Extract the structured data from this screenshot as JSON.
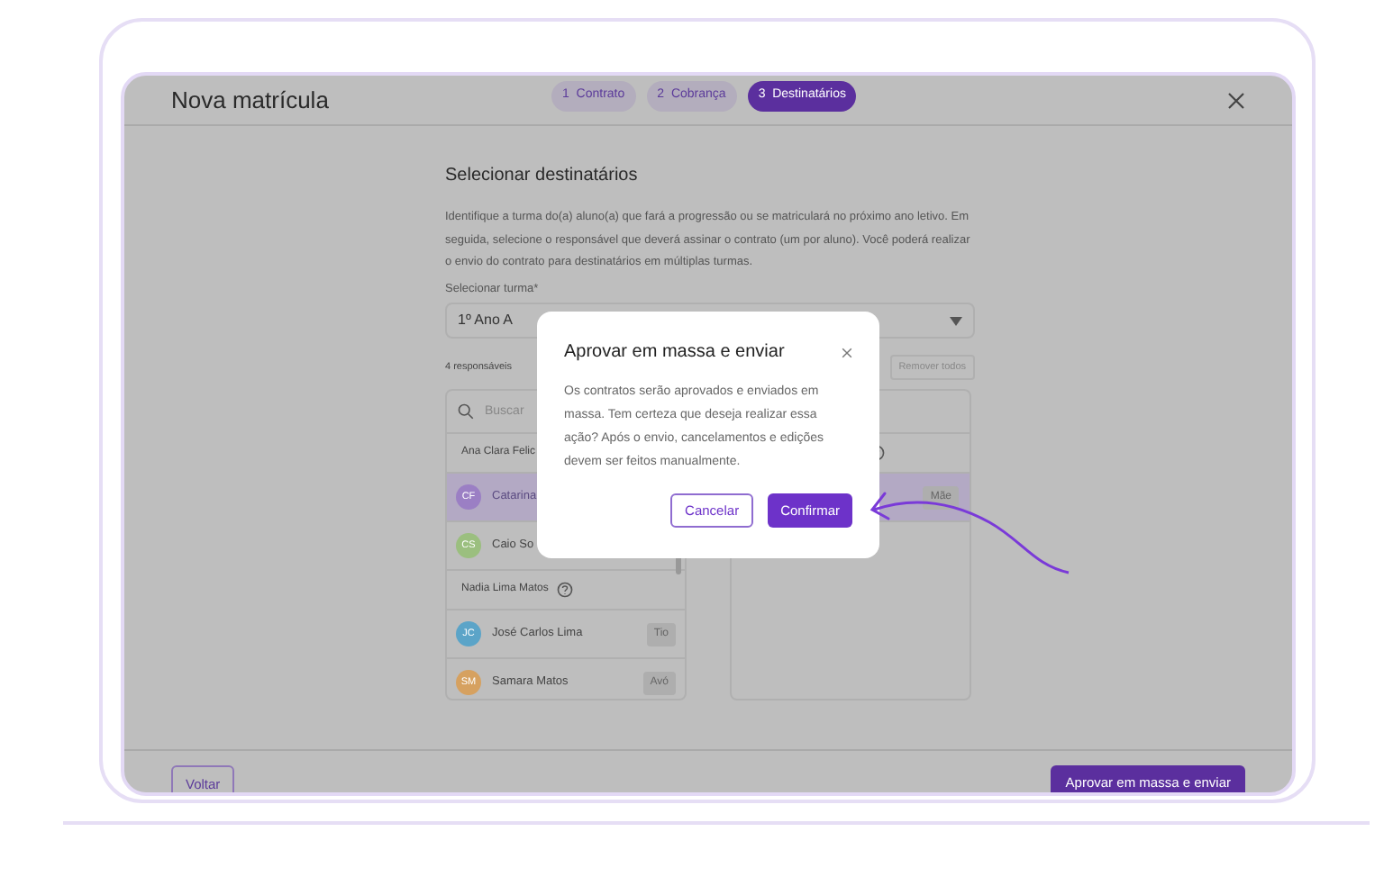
{
  "header": {
    "title": "Nova matrícula",
    "steps": [
      {
        "number": "1",
        "label": "Contrato",
        "selected": false
      },
      {
        "number": "2",
        "label": "Cobrança",
        "selected": false
      },
      {
        "number": "3",
        "label": "Destinatários",
        "selected": true
      }
    ]
  },
  "content": {
    "title": "Selecionar destinatários",
    "description": "Identifique a turma do(a) aluno(a) que fará a progressão ou se matriculará no próximo ano letivo. Em seguida, selecione o responsável que deverá assinar o contrato (um por aluno). Você poderá realizar o envio do contrato para destinatários em múltiplas turmas.",
    "class_select": {
      "label": "Selecionar turma*",
      "value": "1º Ano A"
    },
    "count": "4 responsáveis",
    "remove_all": "Remover todos",
    "search": {
      "placeholder": "Buscar"
    },
    "groups": [
      {
        "name": "Ana Clara Felic",
        "people": [
          {
            "initials": "CF",
            "name": "Catarina",
            "color": "#9b7fc4",
            "selected": true
          },
          {
            "initials": "CS",
            "name": "Caio So",
            "color": "#9bbf7f",
            "selected": false
          }
        ]
      },
      {
        "name": "Nadia Lima Matos",
        "people": [
          {
            "initials": "JC",
            "name": "José Carlos Lima",
            "color": "#5ba4c8",
            "relation": "Tio",
            "selected": false
          },
          {
            "initials": "SM",
            "name": "Samara Matos",
            "color": "#d6a160",
            "relation": "Avó",
            "selected": false
          }
        ]
      }
    ],
    "chosen": [
      {
        "relation": "Mãe",
        "selected": true
      }
    ]
  },
  "dialog": {
    "title": "Aprovar em massa e enviar",
    "message": "Os contratos serão aprovados e enviados em massa. Tem certeza que deseja realizar essa ação? Após o envio, cancelamentos e edições devem ser feitos manualmente.",
    "buttons": [
      {
        "label": "Cancelar",
        "kind": "secondary"
      },
      {
        "label": "Confirmar",
        "kind": "primary"
      }
    ]
  },
  "footer": {
    "back": "Voltar",
    "submit": "Aprovar em massa e enviar"
  }
}
